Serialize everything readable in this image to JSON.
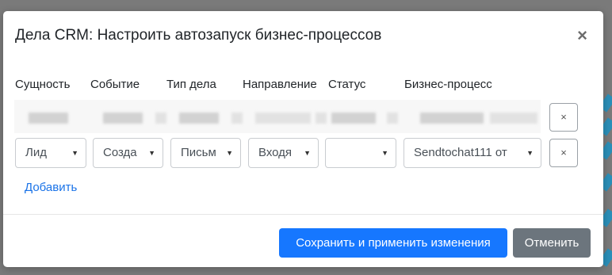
{
  "modal": {
    "title": "Дела CRM: Настроить автозапуск бизнес-процессов",
    "close_glyph": "×"
  },
  "columns": [
    "Сущность",
    "Событие",
    "Тип дела",
    "Направление",
    "Статус",
    "Бизнес-процесс"
  ],
  "rule_row": {
    "entity": "Лид",
    "event": "Созда",
    "activity_type": "Письм",
    "direction": "Входя",
    "status": "",
    "business_process": "Sendtochat111 от"
  },
  "select_caret": "▼",
  "remove_glyph": "×",
  "add_link": "Добавить",
  "footer": {
    "save_label": "Сохранить и применить изменения",
    "cancel_label": "Отменить"
  },
  "colors": {
    "primary": "#1677ff",
    "secondary": "#6c757d",
    "link": "#1a73e8",
    "backdrop": "#7a7a7a"
  }
}
